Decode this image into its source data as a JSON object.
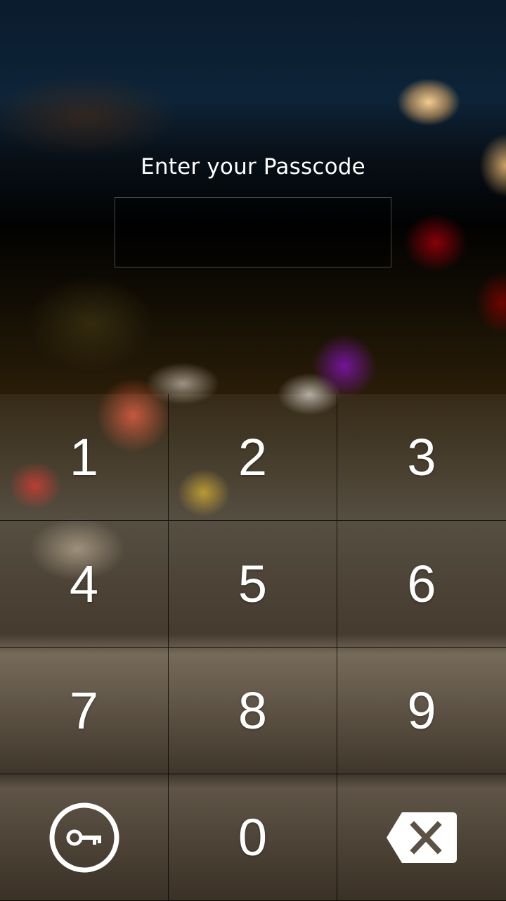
{
  "lock_screen": {
    "title": "Enter your Passcode",
    "passcode_value": ""
  },
  "keypad": {
    "keys": [
      {
        "label": "1"
      },
      {
        "label": "2"
      },
      {
        "label": "3"
      },
      {
        "label": "4"
      },
      {
        "label": "5"
      },
      {
        "label": "6"
      },
      {
        "label": "7"
      },
      {
        "label": "8"
      },
      {
        "label": "9"
      },
      {
        "icon": "key-icon"
      },
      {
        "label": "0"
      },
      {
        "icon": "backspace-icon"
      }
    ]
  },
  "colors": {
    "text": "#ffffff",
    "divider": "#000000"
  }
}
